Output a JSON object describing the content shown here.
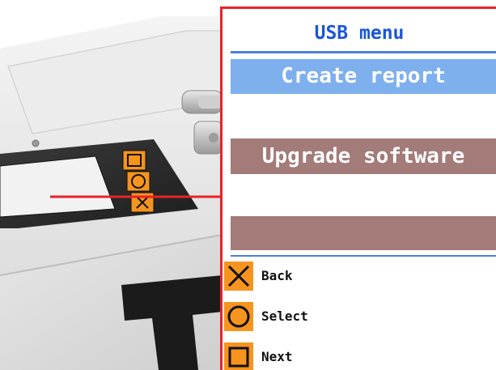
{
  "screen": {
    "title": "USB menu",
    "items": [
      {
        "label": "Create report",
        "state": "highlighted",
        "color": "#7fb0ee"
      },
      {
        "label": "Upgrade software",
        "state": "normal",
        "color": "#a37b79"
      },
      {
        "label": "",
        "state": "normal",
        "color": "#a37b79"
      }
    ],
    "legend": [
      {
        "icon": "cross-icon",
        "label": "Back"
      },
      {
        "icon": "circle-icon",
        "label": "Select"
      },
      {
        "icon": "square-icon",
        "label": "Next"
      }
    ]
  },
  "colors": {
    "accent_red": "#e8222a",
    "title_blue": "#1a56d6",
    "button_orange": "#f5941f"
  }
}
